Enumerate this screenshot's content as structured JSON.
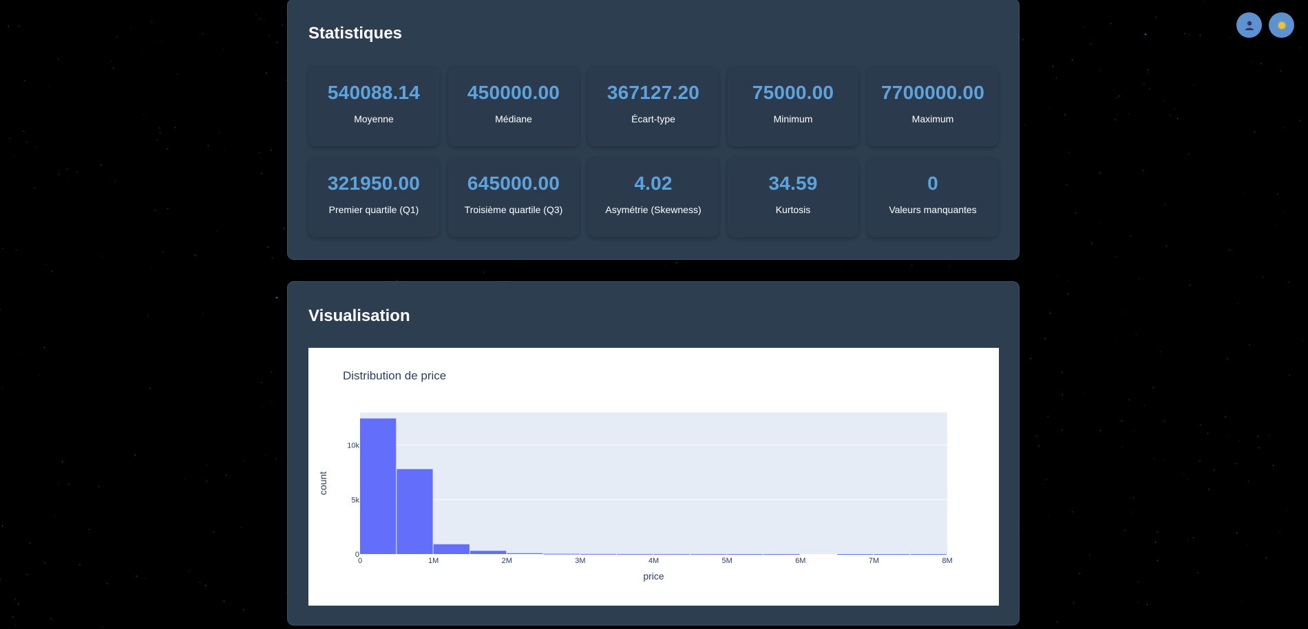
{
  "colors": {
    "background": "#000000",
    "panel": "#2d3e50",
    "accent": "#5ea3dc",
    "bar": "#636efa",
    "plot_bg": "#e5ecf6"
  },
  "header_buttons": {
    "user_icon": "user-icon",
    "theme_icon": "sun-icon"
  },
  "statistics": {
    "title": "Statistiques",
    "cards": [
      {
        "value": "540088.14",
        "label": "Moyenne"
      },
      {
        "value": "450000.00",
        "label": "Médiane"
      },
      {
        "value": "367127.20",
        "label": "Écart-type"
      },
      {
        "value": "75000.00",
        "label": "Minimum"
      },
      {
        "value": "7700000.00",
        "label": "Maximum"
      },
      {
        "value": "321950.00",
        "label": "Premier quartile (Q1)"
      },
      {
        "value": "645000.00",
        "label": "Troisième quartile (Q3)"
      },
      {
        "value": "4.02",
        "label": "Asymétrie (Skewness)"
      },
      {
        "value": "34.59",
        "label": "Kurtosis"
      },
      {
        "value": "0",
        "label": "Valeurs manquantes"
      }
    ]
  },
  "visualisation": {
    "title": "Visualisation"
  },
  "chart_data": {
    "type": "bar",
    "title": "Distribution de price",
    "xlabel": "price",
    "ylabel": "count",
    "bin_edges": [
      0,
      500000,
      1000000,
      1500000,
      2000000,
      2500000,
      3000000,
      3500000,
      4000000,
      4500000,
      5000000,
      5500000,
      6000000,
      6500000,
      7000000,
      7500000,
      8000000
    ],
    "values": [
      12450,
      7800,
      900,
      300,
      80,
      25,
      10,
      5,
      5,
      5,
      2,
      2,
      0,
      1,
      1,
      1
    ],
    "xlim": [
      0,
      8000000
    ],
    "ylim": [
      0,
      13000
    ],
    "x_ticks": [
      0,
      1000000,
      2000000,
      3000000,
      4000000,
      5000000,
      6000000,
      7000000,
      8000000
    ],
    "x_tick_labels": [
      "0",
      "1M",
      "2M",
      "3M",
      "4M",
      "5M",
      "6M",
      "7M",
      "8M"
    ],
    "y_ticks": [
      0,
      5000,
      10000
    ],
    "y_tick_labels": [
      "0",
      "5k",
      "10k"
    ],
    "grid": true,
    "legend": false
  }
}
